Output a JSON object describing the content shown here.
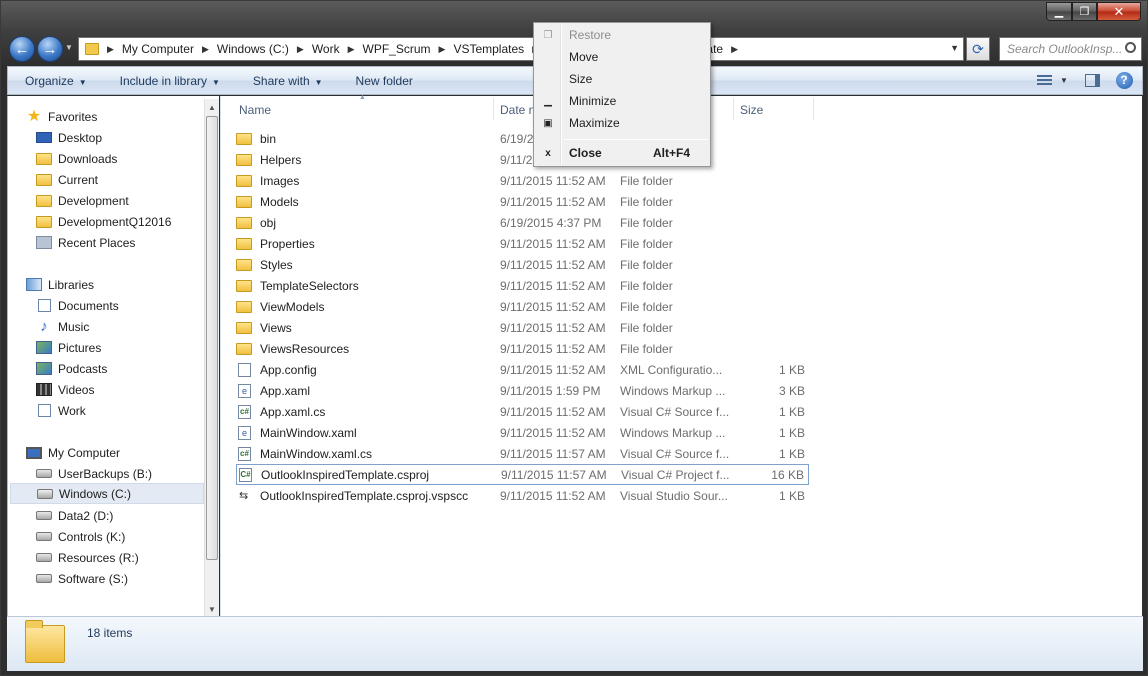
{
  "address": {
    "crumbs": [
      "My Computer",
      "Windows (C:)",
      "Work",
      "WPF_Scrum",
      "VSTemplates",
      "plate"
    ],
    "search_placeholder": "Search OutlookInsp..."
  },
  "toolbar": {
    "organize": "Organize",
    "include_in_library": "Include in library",
    "share_with": "Share with",
    "new_folder": "New folder"
  },
  "nav": {
    "favorites_header": "Favorites",
    "favorites": [
      "Desktop",
      "Downloads",
      "Current",
      "Development",
      "DevelopmentQ12016",
      "Recent Places"
    ],
    "libraries_header": "Libraries",
    "libraries": [
      "Documents",
      "Music",
      "Pictures",
      "Podcasts",
      "Videos",
      "Work"
    ],
    "computer_header": "My Computer",
    "drives": [
      "UserBackups (B:)",
      "Windows (C:)",
      "Data2 (D:)",
      "Controls (K:)",
      "Resources (R:)",
      "Software (S:)"
    ],
    "selected_drive": "Windows (C:)"
  },
  "columns": {
    "name": "Name",
    "date": "Date m",
    "size": "Size"
  },
  "files": [
    {
      "name": "bin",
      "date": "6/19/2",
      "type": "",
      "size": "",
      "kind": "folder"
    },
    {
      "name": "Helpers",
      "date": "9/11/2",
      "type": "",
      "size": "",
      "kind": "folder"
    },
    {
      "name": "Images",
      "date": "9/11/2015 11:52 AM",
      "type": "File folder",
      "size": "",
      "kind": "folder"
    },
    {
      "name": "Models",
      "date": "9/11/2015 11:52 AM",
      "type": "File folder",
      "size": "",
      "kind": "folder"
    },
    {
      "name": "obj",
      "date": "6/19/2015 4:37 PM",
      "type": "File folder",
      "size": "",
      "kind": "folder"
    },
    {
      "name": "Properties",
      "date": "9/11/2015 11:52 AM",
      "type": "File folder",
      "size": "",
      "kind": "folder"
    },
    {
      "name": "Styles",
      "date": "9/11/2015 11:52 AM",
      "type": "File folder",
      "size": "",
      "kind": "folder"
    },
    {
      "name": "TemplateSelectors",
      "date": "9/11/2015 11:52 AM",
      "type": "File folder",
      "size": "",
      "kind": "folder"
    },
    {
      "name": "ViewModels",
      "date": "9/11/2015 11:52 AM",
      "type": "File folder",
      "size": "",
      "kind": "folder"
    },
    {
      "name": "Views",
      "date": "9/11/2015 11:52 AM",
      "type": "File folder",
      "size": "",
      "kind": "folder"
    },
    {
      "name": "ViewsResources",
      "date": "9/11/2015 11:52 AM",
      "type": "File folder",
      "size": "",
      "kind": "folder"
    },
    {
      "name": "App.config",
      "date": "9/11/2015 11:52 AM",
      "type": "XML Configuratio...",
      "size": "1 KB",
      "kind": "file"
    },
    {
      "name": "App.xaml",
      "date": "9/11/2015 1:59 PM",
      "type": "Windows Markup ...",
      "size": "3 KB",
      "kind": "xaml"
    },
    {
      "name": "App.xaml.cs",
      "date": "9/11/2015 11:52 AM",
      "type": "Visual C# Source f...",
      "size": "1 KB",
      "kind": "cs"
    },
    {
      "name": "MainWindow.xaml",
      "date": "9/11/2015 11:52 AM",
      "type": "Windows Markup ...",
      "size": "1 KB",
      "kind": "xaml"
    },
    {
      "name": "MainWindow.xaml.cs",
      "date": "9/11/2015 11:57 AM",
      "type": "Visual C# Source f...",
      "size": "1 KB",
      "kind": "cs"
    },
    {
      "name": "OutlookInspiredTemplate.csproj",
      "date": "9/11/2015 11:57 AM",
      "type": "Visual C# Project f...",
      "size": "16 KB",
      "kind": "csproj"
    },
    {
      "name": "OutlookInspiredTemplate.csproj.vspscc",
      "date": "9/11/2015 11:52 AM",
      "type": "Visual Studio Sour...",
      "size": "1 KB",
      "kind": "vspscc"
    }
  ],
  "selected_file": "OutlookInspiredTemplate.csproj",
  "status": {
    "items_count": "18 items"
  },
  "context_menu": {
    "restore": "Restore",
    "move": "Move",
    "size": "Size",
    "minimize": "Minimize",
    "maximize": "Maximize",
    "close": "Close",
    "close_shortcut": "Alt+F4"
  }
}
